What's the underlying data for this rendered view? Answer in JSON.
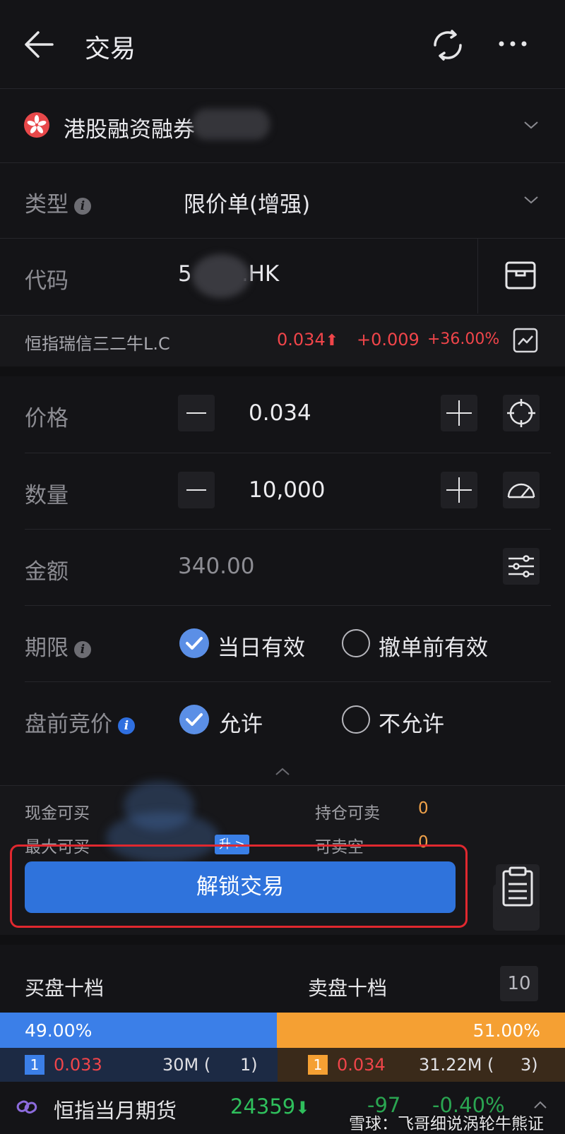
{
  "header": {
    "title": "交易"
  },
  "account": {
    "name": "港股融资融券"
  },
  "order_type": {
    "label": "类型",
    "value": "限价单(增强)"
  },
  "code": {
    "label": "代码",
    "value_prefix": "5",
    "value_suffix": ".HK"
  },
  "quote": {
    "name": "恒指瑞信三二牛L.C",
    "price": "0.034",
    "change": "+0.009",
    "change_pct": "+36.00%"
  },
  "price": {
    "label": "价格",
    "value": "0.034"
  },
  "quantity": {
    "label": "数量",
    "value": "10,000"
  },
  "amount": {
    "label": "金额",
    "value": "340.00"
  },
  "validity": {
    "label": "期限",
    "option_on": "当日有效",
    "option_off": "撤单前有效"
  },
  "premarket": {
    "label": "盘前竞价",
    "option_on": "允许",
    "option_off": "不允许"
  },
  "account_info": {
    "cash_buy_label": "现金可买",
    "max_buy_label": "最大可买",
    "upgrade_badge": "升 >",
    "hold_sell_label": "持仓可卖",
    "hold_sell_value": "0",
    "short_sell_label": "可卖空",
    "short_sell_value": "0"
  },
  "unlock": {
    "label": "解锁交易"
  },
  "orderbook": {
    "bid_title": "买盘十档",
    "ask_title": "卖盘十档",
    "depth_label": "10",
    "bid_pct": "49.00%",
    "ask_pct": "51.00%",
    "bid_ratio": 0.49,
    "bid_rank": "1",
    "bid_price": "0.033",
    "bid_volume": "30M (",
    "bid_count": "1)",
    "ask_rank": "1",
    "ask_price": "0.034",
    "ask_volume": "31.22M (",
    "ask_count": "3)"
  },
  "footer": {
    "name": "恒指当月期货",
    "price": "24359",
    "change": "-97",
    "change_pct": "-0.40%",
    "watermark": "雪球：飞哥细说涡轮牛熊证"
  },
  "colors": {
    "accent": "#2f73dc",
    "up": "#f0454a",
    "down": "#2fbf5c",
    "orange": "#f5a033",
    "bid": "#3b7fe8"
  }
}
